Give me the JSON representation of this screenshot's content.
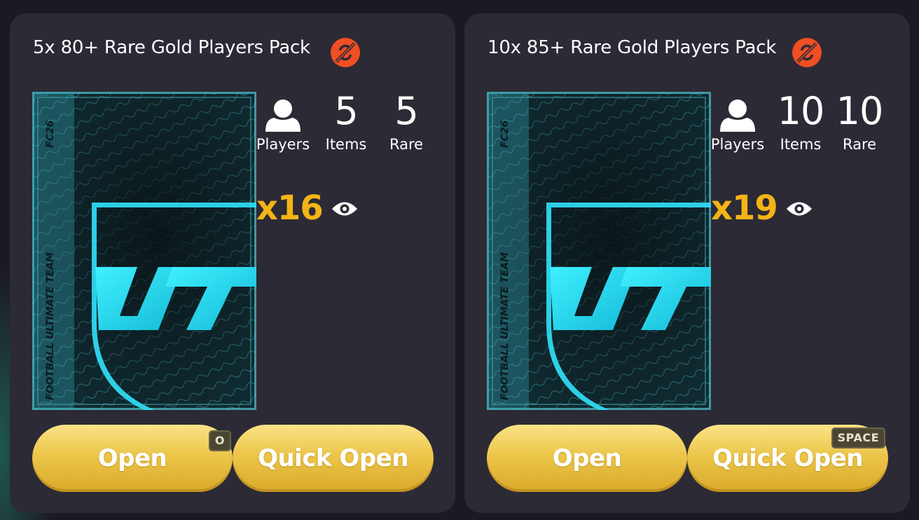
{
  "cards": [
    {
      "title": "5x 80+ Rare Gold Players Pack",
      "stats": {
        "players_label": "Players",
        "items_value": "5",
        "items_label": "Items",
        "rare_value": "5",
        "rare_label": "Rare"
      },
      "count": "x16",
      "open_label": "Open",
      "open_shortcut": "O",
      "quick_open_label": "Quick Open",
      "quick_open_shortcut": ""
    },
    {
      "title": "10x 85+ Rare Gold Players Pack",
      "stats": {
        "players_label": "Players",
        "items_value": "10",
        "items_label": "Items",
        "rare_value": "10",
        "rare_label": "Rare"
      },
      "count": "x19",
      "open_label": "Open",
      "open_shortcut": "",
      "quick_open_label": "Quick Open",
      "quick_open_shortcut": "SPACE"
    }
  ],
  "pack_art": {
    "brand": "FC26",
    "side_text": "FOOTBALL ULTIMATE TEAM",
    "logo": "UT"
  },
  "icons": {
    "untradeable": "no-trade-icon",
    "players": "person-icon",
    "view": "eye-icon"
  },
  "colors": {
    "card_bg": "#2c2a35",
    "count_gold": "#f5b416",
    "untradeable_red": "#f04e23",
    "button_gold": "#ecc64a",
    "pack_cyan": "#2fd9f0"
  }
}
